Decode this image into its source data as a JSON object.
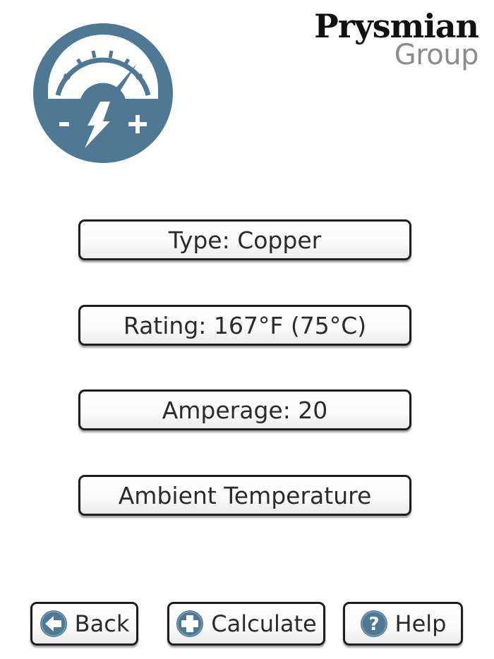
{
  "header": {
    "app_icon": "ampacity-gauge-icon",
    "logo": {
      "brand": "Prysmian",
      "group": "Group"
    }
  },
  "options": {
    "type_label": "Type: Copper",
    "rating_label": "Rating: 167°F (75°C)",
    "amperage_label": "Amperage: 20",
    "ambient_label": "Ambient Temperature"
  },
  "footer": {
    "back_label": "Back",
    "calculate_label": "Calculate",
    "help_label": "Help"
  },
  "colors": {
    "accent": "#4f7894",
    "button_border": "#1e1e1e",
    "text": "#2b2b2b",
    "logo_group": "#8c8c8c"
  },
  "icons": {
    "back": "arrow-left-icon",
    "calculate": "plus-icon",
    "help": "question-icon"
  }
}
